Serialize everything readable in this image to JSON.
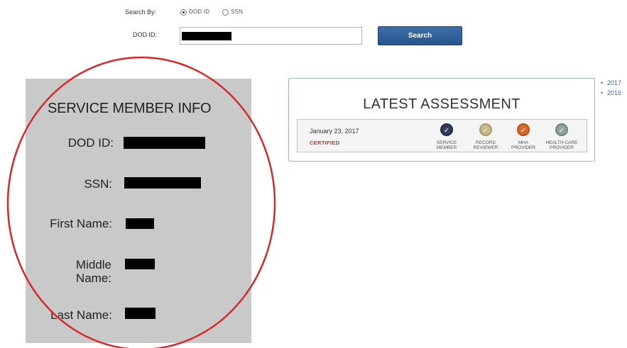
{
  "search": {
    "by_label": "Search By:",
    "options": [
      {
        "label": "DOD ID",
        "selected": true
      },
      {
        "label": "SSN",
        "selected": false
      }
    ],
    "dod_label": "DOD ID:",
    "dod_value_redacted": true,
    "button_label": "Search"
  },
  "member": {
    "title": "SERVICE MEMBER INFO",
    "fields": [
      {
        "label": "DOD ID:",
        "redacted": true
      },
      {
        "label": "SSN:",
        "redacted": true
      },
      {
        "label": "First Name:",
        "redacted": true
      },
      {
        "label_line1": "Middle",
        "label_line2": "Name:",
        "redacted": true
      },
      {
        "label": "Last Name:",
        "redacted": true
      }
    ]
  },
  "assessment": {
    "title": "LATEST ASSESSMENT",
    "date": "January 23, 2017",
    "status": "CERTIFIED",
    "steps": [
      {
        "line1": "SERVICE",
        "line2": "MEMBER",
        "icon": "check-icon",
        "color": "#2e3f5c"
      },
      {
        "line1": "RECORD",
        "line2": "REVIEWER",
        "icon": "check-icon",
        "color": "#c9b98a"
      },
      {
        "line1": "MHA",
        "line2": "PROVIDER",
        "icon": "check-icon",
        "color": "#d8692a"
      },
      {
        "line1": "HEALTH CARE",
        "line2": "PROVIDER",
        "icon": "check-icon",
        "color": "#8ea49c"
      }
    ]
  },
  "years": [
    "2017",
    "2016"
  ],
  "colors": {
    "button": "#2f609a",
    "panel": "#c9c9c9",
    "annotation_circle": "#d42a2a",
    "certified": "#b03a2e",
    "link": "#3a6fb0"
  }
}
